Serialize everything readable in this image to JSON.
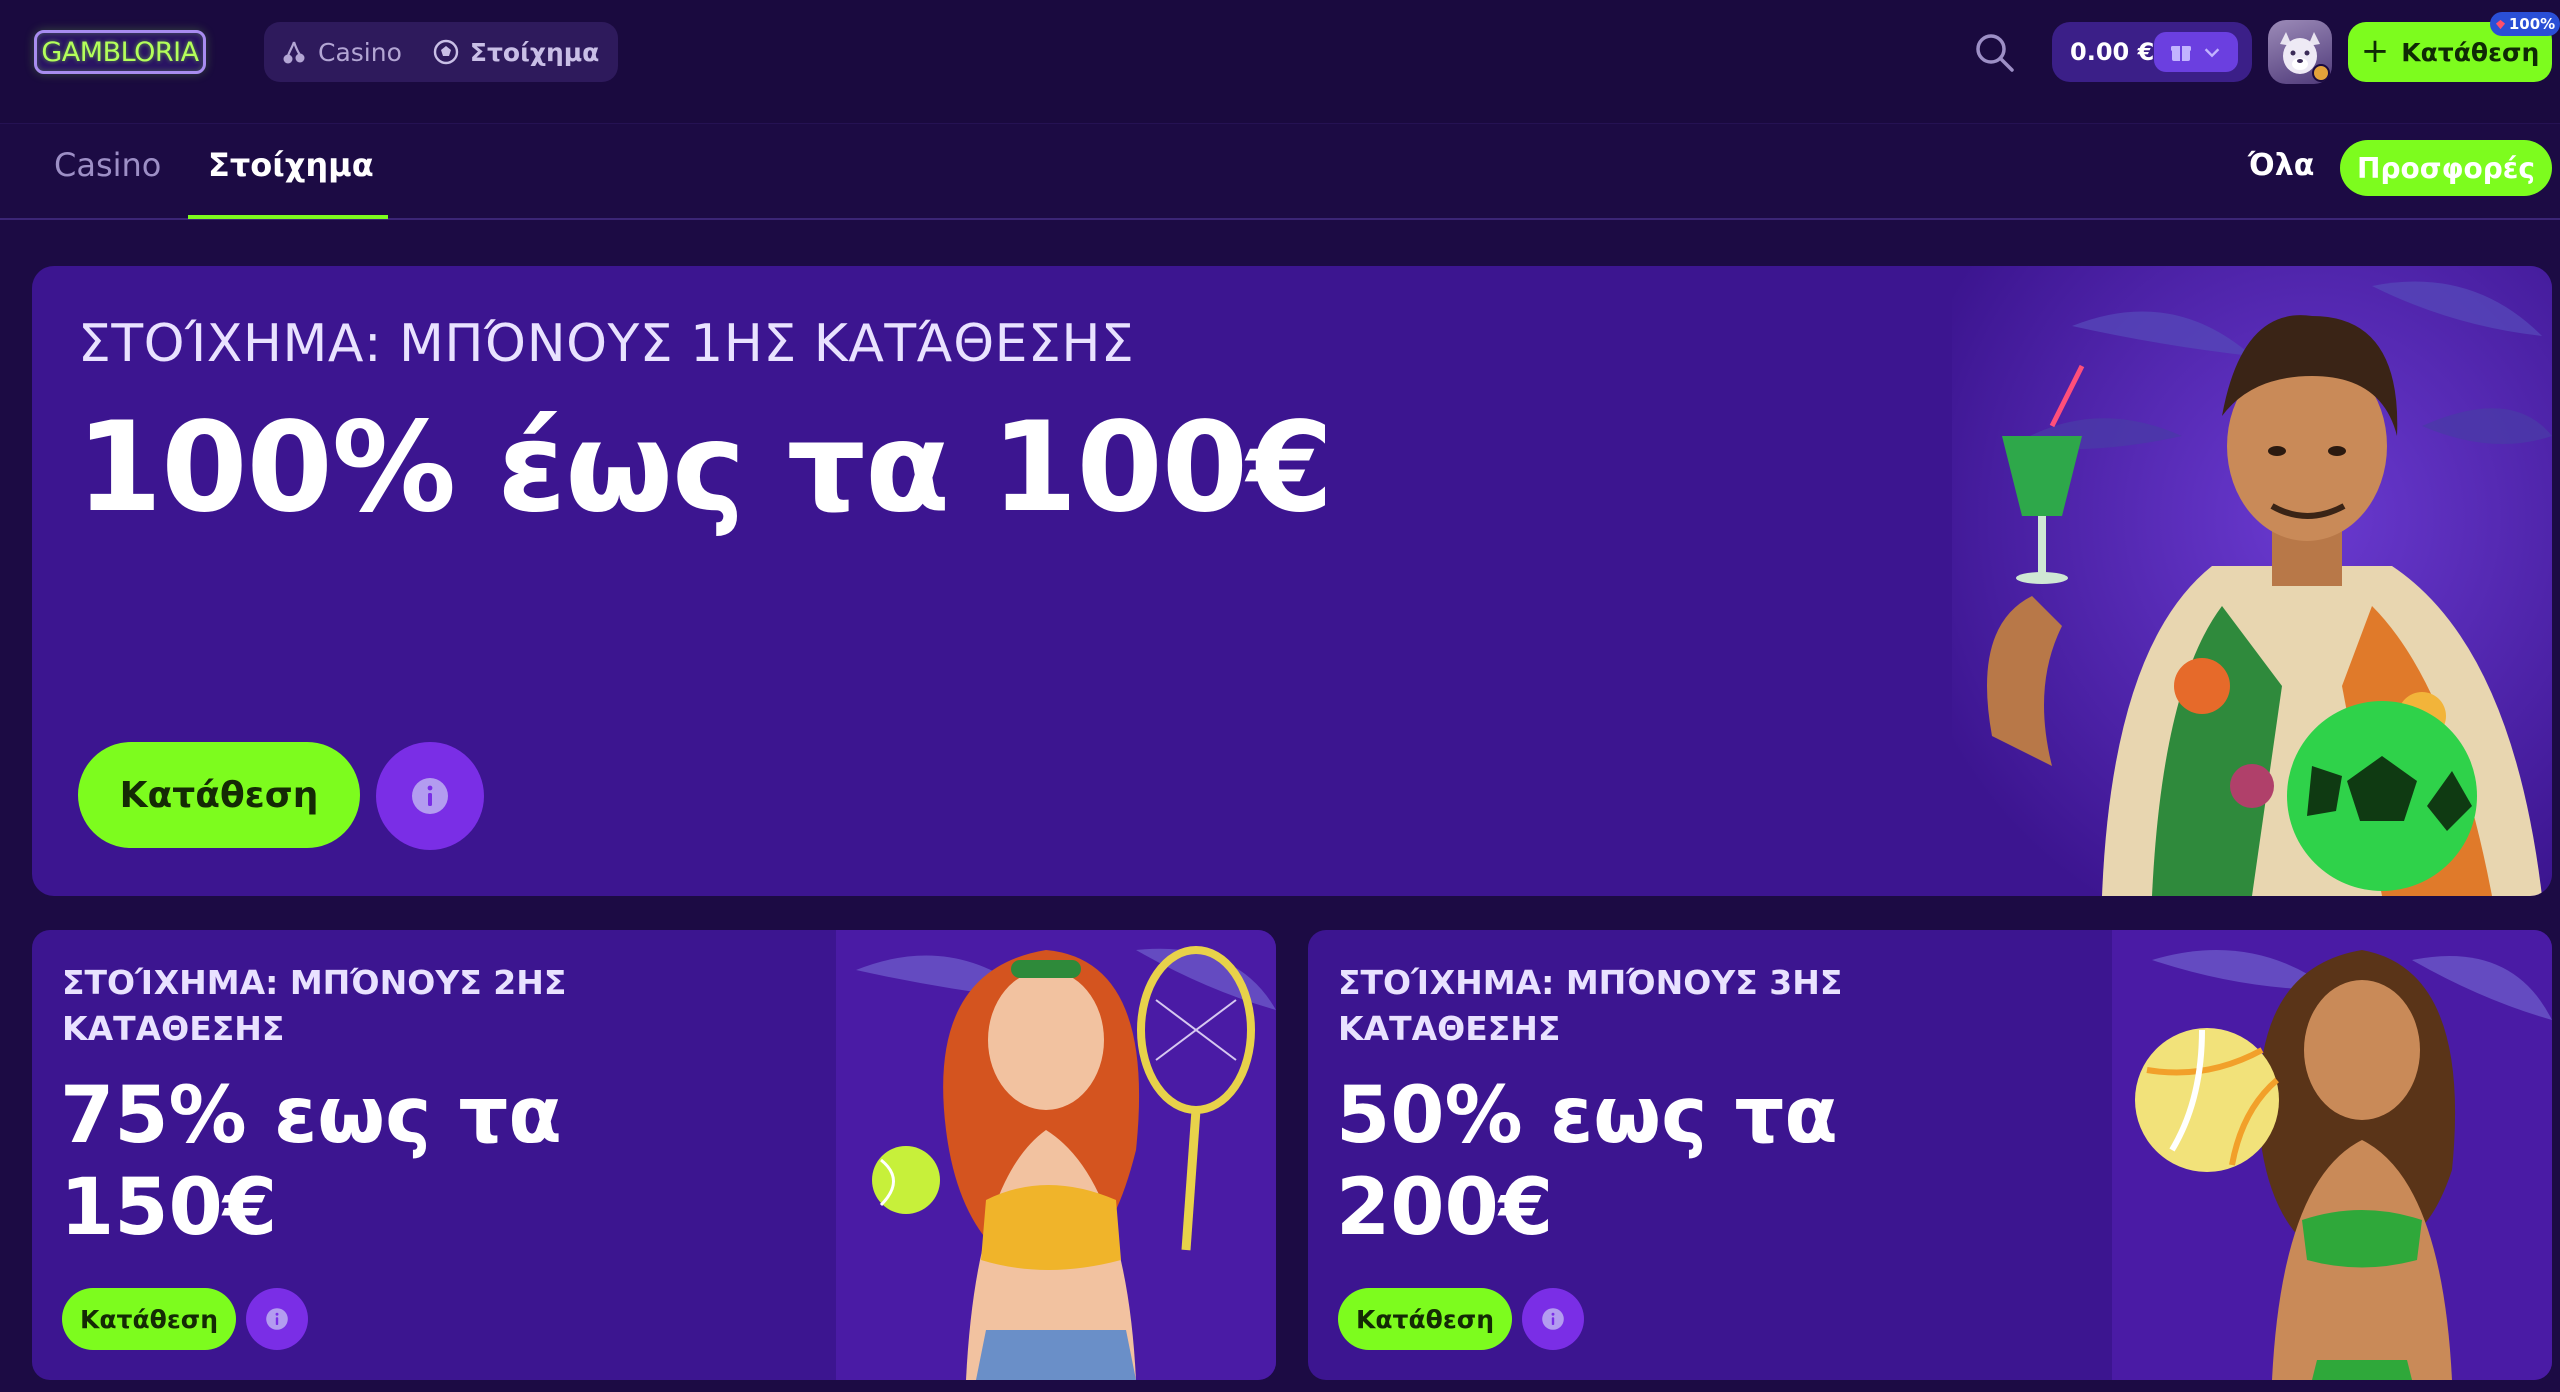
{
  "header": {
    "logo_text": "GAMBLORIA",
    "product_tabs": [
      {
        "label": "Casino",
        "icon": "cherry-icon"
      },
      {
        "label": "Στοίχημα",
        "icon": "football-icon"
      }
    ],
    "balance": "0.00 €",
    "deposit_label": "Κατάθεση",
    "bonus_badge": "100%"
  },
  "subnav": {
    "tabs": [
      {
        "label": "Casino",
        "active": false
      },
      {
        "label": "Στοίχημα",
        "active": true
      }
    ],
    "all_label": "Όλα",
    "offers_label": "Προσφορές"
  },
  "hero": {
    "eyebrow": "ΣΤΟΊΧΗΜΑ: ΜΠΌΝΟΥΣ 1ΗΣ ΚΑΤΆΘΕΣΗΣ",
    "headline": "100% έως τα 100€",
    "cta_label": "Κατάθεση"
  },
  "promos": [
    {
      "eyebrow": "ΣΤΟΊΧΗΜΑ: ΜΠΌΝΟΥΣ 2ΗΣ ΚΑΤΑΘΕΣΗΣ",
      "headline": "75% εως τα 150€",
      "cta_label": "Κατάθεση"
    },
    {
      "eyebrow": "ΣΤΟΊΧΗΜΑ: ΜΠΌΝΟΥΣ 3ΗΣ ΚΑΤΑΘΕΣΗΣ",
      "headline": "50% εως τα 200€",
      "cta_label": "Κατάθεση"
    }
  ],
  "colors": {
    "background": "#1c0b44",
    "card": "#3c1590",
    "accent_green": "#7dfc1e",
    "info_purple": "#7a2ee6"
  }
}
